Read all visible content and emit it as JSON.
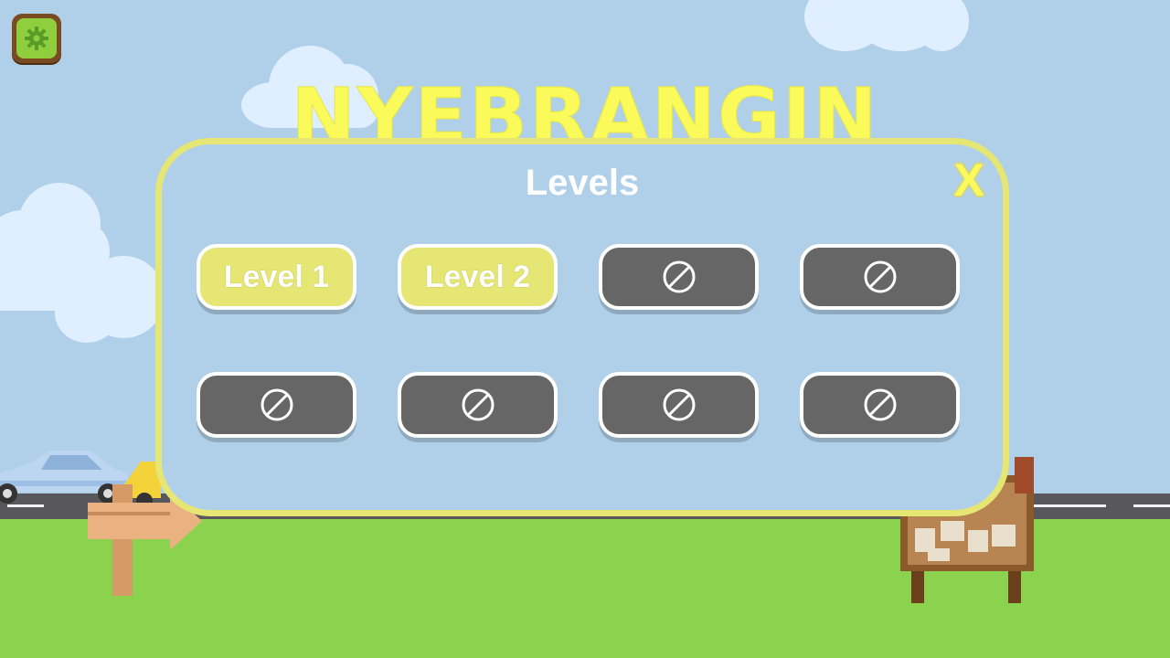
{
  "game_title": "NYEBRANGIN",
  "colors": {
    "sky": "#afd0e8",
    "grass": "#8bd34e",
    "road": "#58585c",
    "modal_border": "#e6e674",
    "unlocked_button": "#e6e674",
    "locked_button": "#666666",
    "title_yellow": "#fafa5a"
  },
  "settings_button": {
    "icon": "gear-icon"
  },
  "levels_dialog": {
    "title": "Levels",
    "close_label": "X",
    "levels": [
      {
        "label": "Level 1",
        "locked": false
      },
      {
        "label": "Level 2",
        "locked": false
      },
      {
        "label": "",
        "locked": true,
        "icon": "locked-icon"
      },
      {
        "label": "",
        "locked": true,
        "icon": "locked-icon"
      },
      {
        "label": "",
        "locked": true,
        "icon": "locked-icon"
      },
      {
        "label": "",
        "locked": true,
        "icon": "locked-icon"
      },
      {
        "label": "",
        "locked": true,
        "icon": "locked-icon"
      },
      {
        "label": "",
        "locked": true,
        "icon": "locked-icon"
      }
    ]
  }
}
